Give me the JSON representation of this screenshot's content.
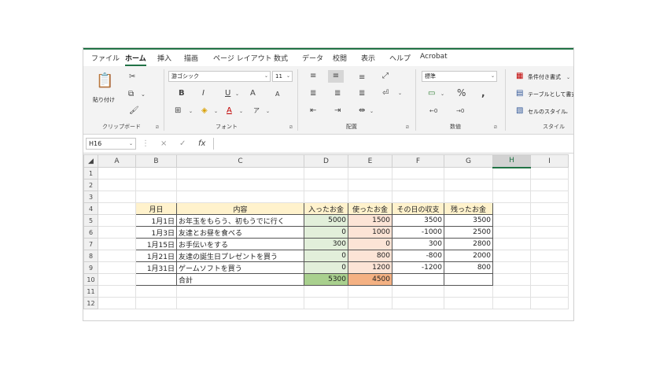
{
  "ribbon_tabs": [
    "ファイル",
    "ホーム",
    "挿入",
    "描画",
    "ページ レイアウト",
    "数式",
    "データ",
    "校閲",
    "表示",
    "ヘルプ",
    "Acrobat"
  ],
  "ribbon": {
    "clipboard": {
      "paste": "貼り付け",
      "label": "クリップボード"
    },
    "font": {
      "name": "游ゴシック",
      "size": "11",
      "bold": "B",
      "italic": "I",
      "underline": "U",
      "grow": "A",
      "shrink": "A",
      "font_color": "A",
      "label": "フォント"
    },
    "alignment": {
      "label": "配置"
    },
    "number": {
      "format": "標準",
      "percent": "%",
      "comma": ",",
      "label": "数値"
    },
    "styles": {
      "conditional": "条件付き書式",
      "as_table": "テーブルとして書式",
      "cell_styles": "セルのスタイル",
      "label": "スタイル"
    }
  },
  "formula_bar": {
    "name_box": "H16",
    "fx": "fx",
    "cancel": "×",
    "enter": "✓"
  },
  "columns": [
    "A",
    "B",
    "C",
    "D",
    "E",
    "F",
    "G",
    "H",
    "I"
  ],
  "rows": [
    {
      "n": "1",
      "date": "",
      "item": "",
      "in": "",
      "out": "",
      "diff": "",
      "bal": ""
    },
    {
      "n": "2",
      "date": "",
      "item": "",
      "in": "",
      "out": "",
      "diff": "",
      "bal": ""
    },
    {
      "n": "3",
      "date": "",
      "item": "",
      "in": "",
      "out": "",
      "diff": "",
      "bal": ""
    },
    {
      "n": "4",
      "date": "月日",
      "item": "内容",
      "in": "入ったお金",
      "out": "使ったお金",
      "diff": "その日の収支",
      "bal": "残ったお金"
    },
    {
      "n": "5",
      "date": "1月1日",
      "item": "お年玉をもらう、初もうでに行く",
      "in": "5000",
      "out": "1500",
      "diff": "3500",
      "bal": "3500"
    },
    {
      "n": "6",
      "date": "1月3日",
      "item": "友達とお昼を食べる",
      "in": "0",
      "out": "1000",
      "diff": "-1000",
      "bal": "2500"
    },
    {
      "n": "7",
      "date": "1月15日",
      "item": "お手伝いをする",
      "in": "300",
      "out": "0",
      "diff": "300",
      "bal": "2800"
    },
    {
      "n": "8",
      "date": "1月21日",
      "item": "友達の誕生日プレゼントを買う",
      "in": "0",
      "out": "800",
      "diff": "-800",
      "bal": "2000"
    },
    {
      "n": "9",
      "date": "1月31日",
      "item": "ゲームソフトを買う",
      "in": "0",
      "out": "1200",
      "diff": "-1200",
      "bal": "800"
    },
    {
      "n": "10",
      "date": "",
      "item": "合計",
      "in": "5300",
      "out": "4500",
      "diff": "",
      "bal": ""
    },
    {
      "n": "11",
      "date": "",
      "item": "",
      "in": "",
      "out": "",
      "diff": "",
      "bal": ""
    },
    {
      "n": "12",
      "date": "",
      "item": "",
      "in": "",
      "out": "",
      "diff": "",
      "bal": ""
    }
  ],
  "colors": {
    "accent": "#217346",
    "header_fill": "#fff2cc",
    "income_fill": "#e2efda",
    "expense_fill": "#fce4d6",
    "income_total": "#a9d08e",
    "expense_total": "#f4b183"
  },
  "icons": [
    "paste-icon",
    "cut-icon",
    "copy-icon",
    "format-painter-icon",
    "borders-icon",
    "fill-color-icon",
    "font-color-icon",
    "align-icon",
    "wrap-text-icon",
    "merge-center-icon",
    "orientation-icon",
    "currency-icon",
    "decimal-icon",
    "conditional-format-icon",
    "table-format-icon",
    "cell-styles-icon",
    "dialog-launcher-icon",
    "chevron-down-icon"
  ]
}
